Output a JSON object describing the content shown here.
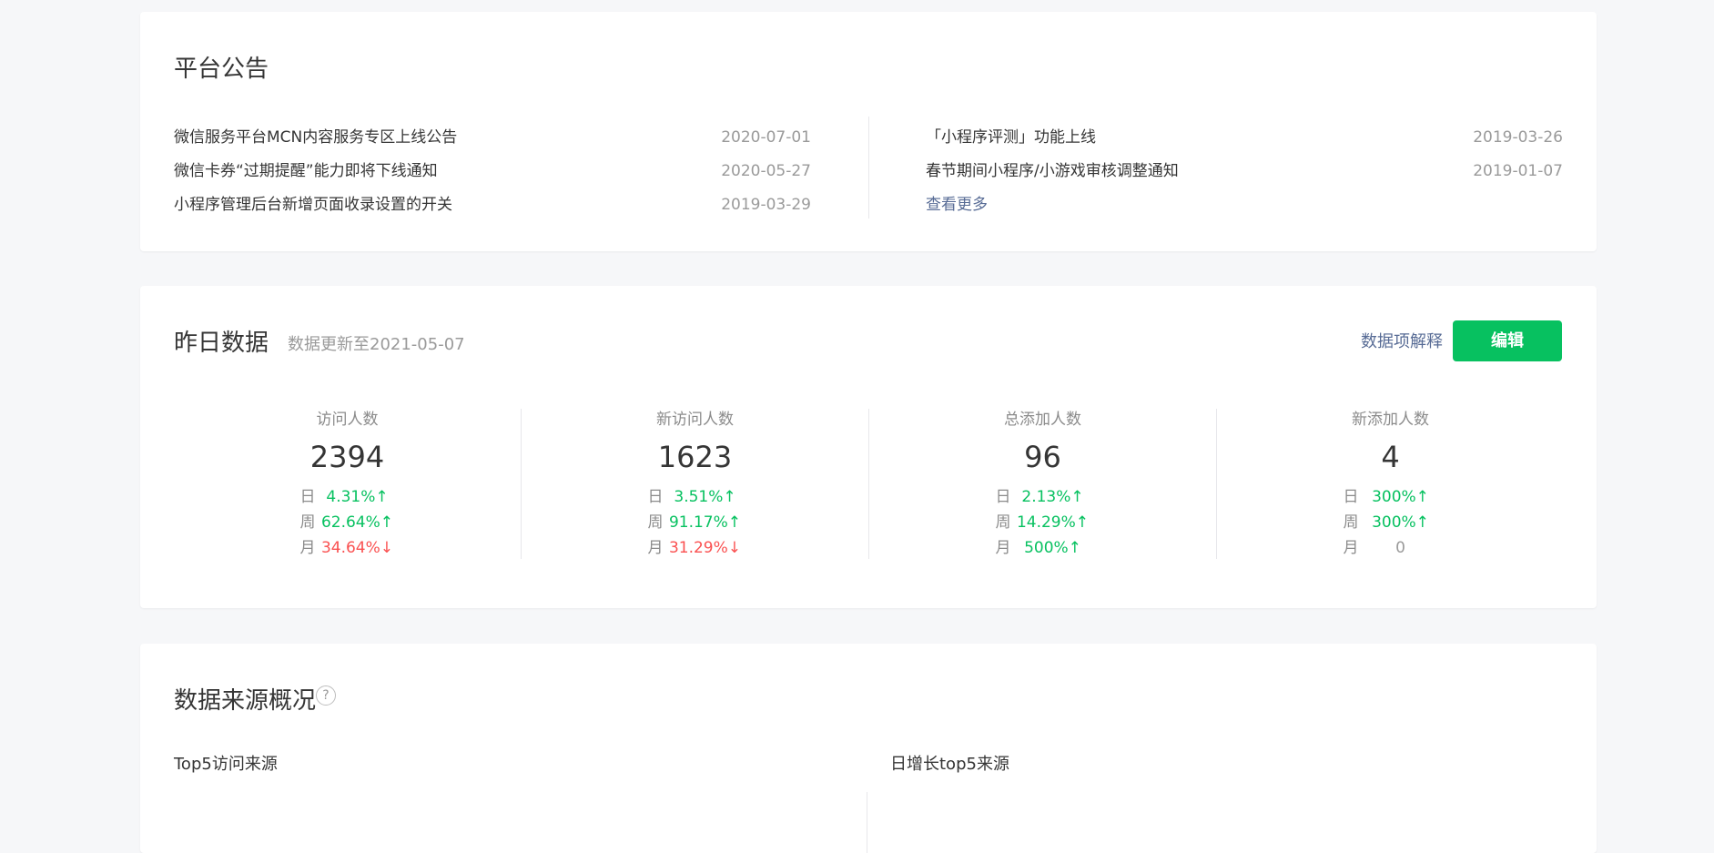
{
  "notice": {
    "title": "平台公告",
    "left": [
      {
        "title": "微信服务平台MCN内容服务专区上线公告",
        "date": "2020-07-01"
      },
      {
        "title": "微信卡券“过期提醒”能力即将下线通知",
        "date": "2020-05-27"
      },
      {
        "title": "小程序管理后台新增页面收录设置的开关",
        "date": "2019-03-29"
      }
    ],
    "right": [
      {
        "title": "「小程序评测」功能上线",
        "date": "2019-03-26"
      },
      {
        "title": "春节期间小程序/小游戏审核调整通知",
        "date": "2019-01-07"
      }
    ],
    "more_label": "查看更多"
  },
  "yesterday": {
    "title": "昨日数据",
    "updated": "数据更新至2021-05-07",
    "explain_label": "数据项解释",
    "edit_label": "编辑",
    "metrics": [
      {
        "label": "访问人数",
        "value": "2394",
        "rows": [
          {
            "period": "日",
            "change": "4.31%↑",
            "trend": "up"
          },
          {
            "period": "周",
            "change": "62.64%↑",
            "trend": "up"
          },
          {
            "period": "月",
            "change": "34.64%↓",
            "trend": "down"
          }
        ]
      },
      {
        "label": "新访问人数",
        "value": "1623",
        "rows": [
          {
            "period": "日",
            "change": "3.51%↑",
            "trend": "up"
          },
          {
            "period": "周",
            "change": "91.17%↑",
            "trend": "up"
          },
          {
            "period": "月",
            "change": "31.29%↓",
            "trend": "down"
          }
        ]
      },
      {
        "label": "总添加人数",
        "value": "96",
        "rows": [
          {
            "period": "日",
            "change": "2.13%↑",
            "trend": "up"
          },
          {
            "period": "周",
            "change": "14.29%↑",
            "trend": "up"
          },
          {
            "period": "月",
            "change": "500%↑",
            "trend": "up"
          }
        ]
      },
      {
        "label": "新添加人数",
        "value": "4",
        "rows": [
          {
            "period": "日",
            "change": "300%↑",
            "trend": "up"
          },
          {
            "period": "周",
            "change": "300%↑",
            "trend": "up"
          },
          {
            "period": "月",
            "change": "0",
            "trend": "flat"
          }
        ]
      }
    ]
  },
  "source": {
    "title": "数据来源概况",
    "help_icon": "question-circle-icon",
    "help_glyph": "?",
    "left_label": "Top5访问来源",
    "right_label": "日增长top5来源"
  },
  "colors": {
    "up": "#07c160",
    "down": "#fa5151",
    "link": "#576b95",
    "primary_button": "#07c160"
  }
}
